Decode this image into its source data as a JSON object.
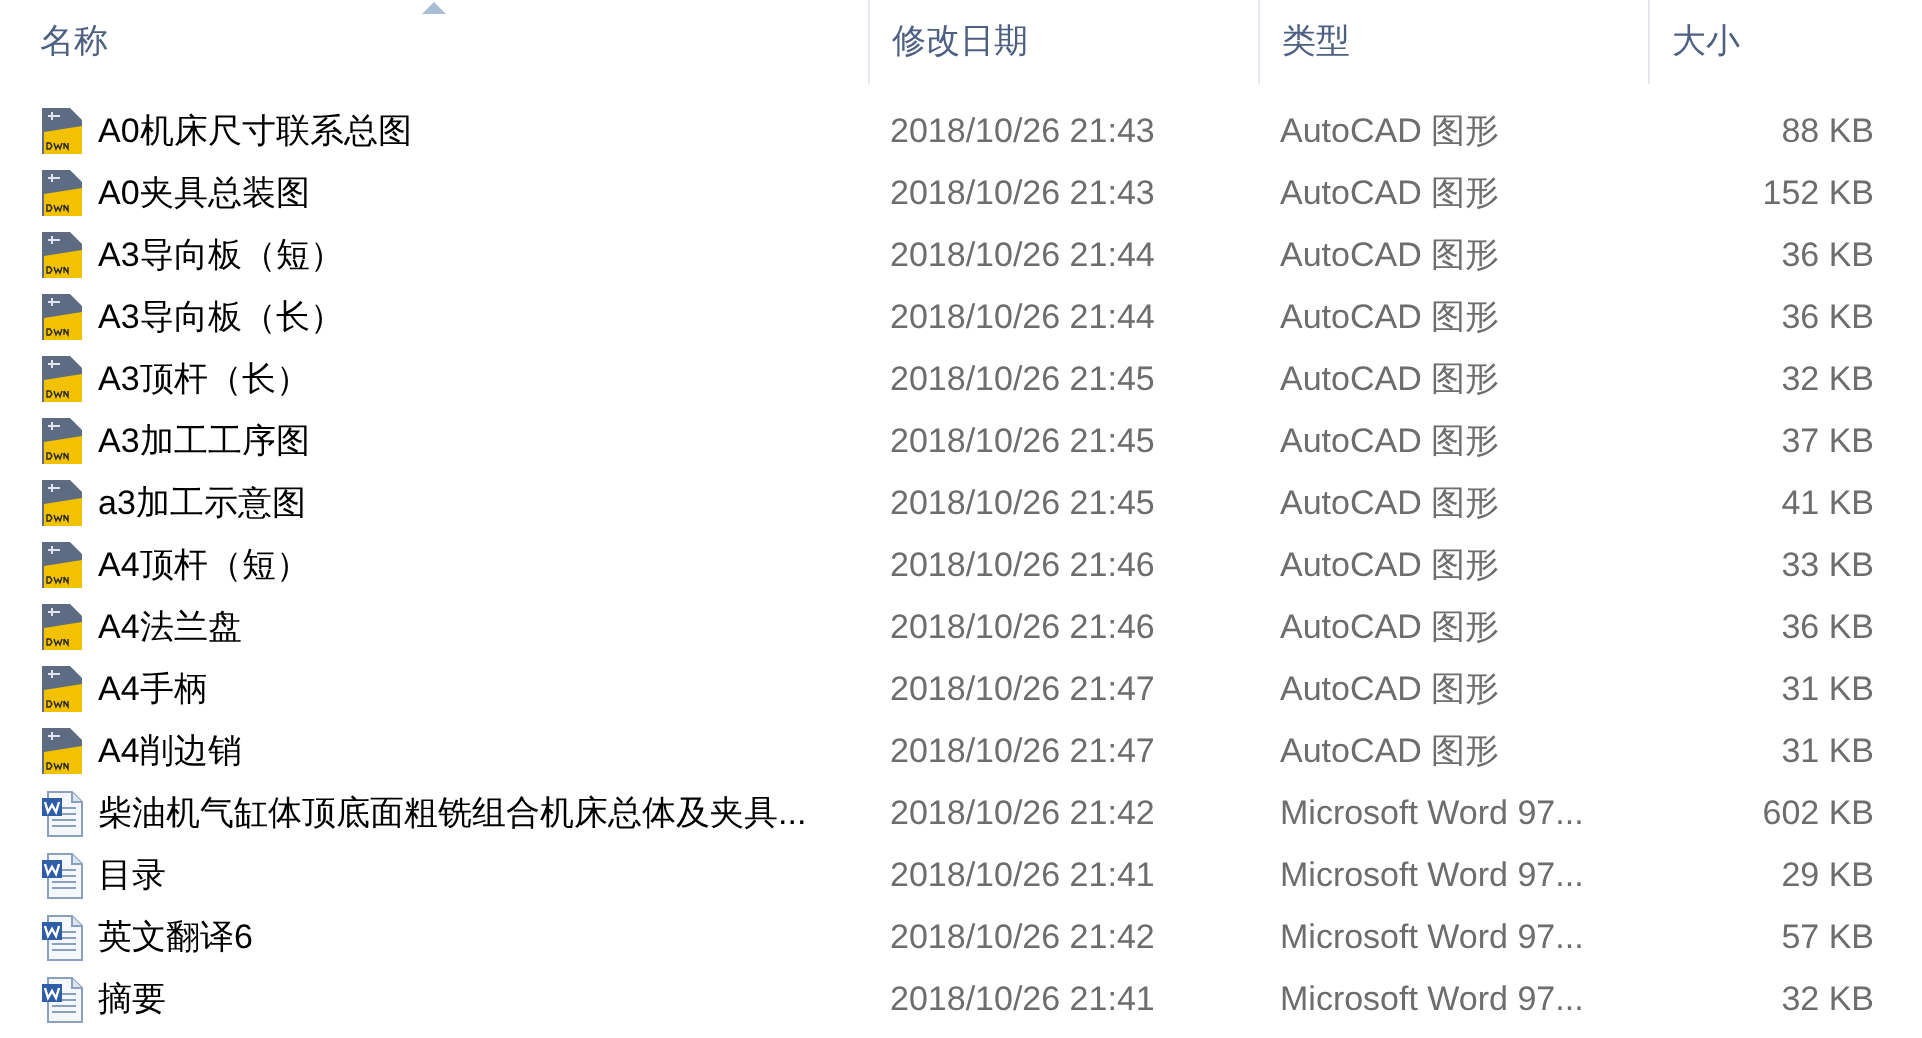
{
  "columns": [
    {
      "label": "名称",
      "sorted": true
    },
    {
      "label": "修改日期",
      "sorted": false
    },
    {
      "label": "类型",
      "sorted": false
    },
    {
      "label": "大小",
      "sorted": false
    }
  ],
  "files": [
    {
      "kind": "dwg",
      "name": "A0机床尺寸联系总图",
      "modified": "2018/10/26 21:43",
      "type": "AutoCAD 图形",
      "size": "88 KB"
    },
    {
      "kind": "dwg",
      "name": "A0夹具总装图",
      "modified": "2018/10/26 21:43",
      "type": "AutoCAD 图形",
      "size": "152 KB"
    },
    {
      "kind": "dwg",
      "name": "A3导向板（短）",
      "modified": "2018/10/26 21:44",
      "type": "AutoCAD 图形",
      "size": "36 KB"
    },
    {
      "kind": "dwg",
      "name": "A3导向板（长）",
      "modified": "2018/10/26 21:44",
      "type": "AutoCAD 图形",
      "size": "36 KB"
    },
    {
      "kind": "dwg",
      "name": "A3顶杆（长）",
      "modified": "2018/10/26 21:45",
      "type": "AutoCAD 图形",
      "size": "32 KB"
    },
    {
      "kind": "dwg",
      "name": "A3加工工序图",
      "modified": "2018/10/26 21:45",
      "type": "AutoCAD 图形",
      "size": "37 KB"
    },
    {
      "kind": "dwg",
      "name": "a3加工示意图",
      "modified": "2018/10/26 21:45",
      "type": "AutoCAD 图形",
      "size": "41 KB"
    },
    {
      "kind": "dwg",
      "name": "A4顶杆（短）",
      "modified": "2018/10/26 21:46",
      "type": "AutoCAD 图形",
      "size": "33 KB"
    },
    {
      "kind": "dwg",
      "name": "A4法兰盘",
      "modified": "2018/10/26 21:46",
      "type": "AutoCAD 图形",
      "size": "36 KB"
    },
    {
      "kind": "dwg",
      "name": "A4手柄",
      "modified": "2018/10/26 21:47",
      "type": "AutoCAD 图形",
      "size": "31 KB"
    },
    {
      "kind": "dwg",
      "name": "A4削边销",
      "modified": "2018/10/26 21:47",
      "type": "AutoCAD 图形",
      "size": "31 KB"
    },
    {
      "kind": "word",
      "name": "柴油机气缸体顶底面粗铣组合机床总体及夹具...",
      "modified": "2018/10/26 21:42",
      "type": "Microsoft Word 97...",
      "size": "602 KB"
    },
    {
      "kind": "word",
      "name": "目录",
      "modified": "2018/10/26 21:41",
      "type": "Microsoft Word 97...",
      "size": "29 KB"
    },
    {
      "kind": "word",
      "name": "英文翻译6",
      "modified": "2018/10/26 21:42",
      "type": "Microsoft Word 97...",
      "size": "57 KB"
    },
    {
      "kind": "word",
      "name": "摘要",
      "modified": "2018/10/26 21:41",
      "type": "Microsoft Word 97...",
      "size": "32 KB"
    }
  ]
}
